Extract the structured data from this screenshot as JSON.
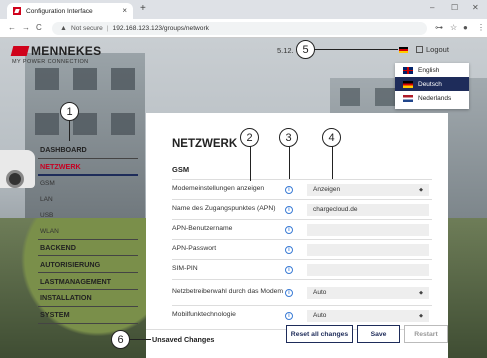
{
  "browser": {
    "tab_title": "Configuration Interface",
    "tab_close": "×",
    "new_tab": "+",
    "url_warning": "Not secure",
    "url_separator": "|",
    "url": "192.168.123.123/groups/network",
    "window_controls": [
      "–",
      "☐",
      "✕"
    ]
  },
  "header": {
    "brand": "MENNEKES",
    "tagline": "MY POWER CONNECTION",
    "version": "5.12.",
    "logout": "Logout"
  },
  "languages": [
    {
      "label": "English",
      "flag": "uk"
    },
    {
      "label": "Deutsch",
      "flag": "de",
      "selected": true
    },
    {
      "label": "Nederlands",
      "flag": "nl"
    }
  ],
  "sidebar": {
    "items": [
      {
        "label": "DASHBOARD"
      },
      {
        "label": "NETZWERK",
        "active": true
      },
      {
        "label": "GSM",
        "sub": true
      },
      {
        "label": "LAN",
        "sub": true
      },
      {
        "label": "USB",
        "sub": true
      },
      {
        "label": "WLAN",
        "sub": true
      },
      {
        "label": "BACKEND"
      },
      {
        "label": "AUTORISIERUNG"
      },
      {
        "label": "LASTMANAGEMENT"
      },
      {
        "label": "INSTALLATION"
      },
      {
        "label": "SYSTEM"
      }
    ]
  },
  "panel": {
    "title": "NETZWERK",
    "subtitle": "GSM",
    "rows": [
      {
        "label": "Modemeinstellungen anzeigen",
        "value": "Anzeigen",
        "type": "select"
      },
      {
        "label": "Name des Zugangspunktes (APN)",
        "value": "chargecloud.de",
        "type": "input"
      },
      {
        "label": "APN-Benutzername",
        "value": "",
        "type": "input"
      },
      {
        "label": "APN-Passwort",
        "value": "",
        "type": "input"
      },
      {
        "label": "SIM-PIN",
        "value": "",
        "type": "input"
      },
      {
        "label": "Netzbetreiberwahl durch das Modem",
        "value": "Auto",
        "type": "select"
      },
      {
        "label": "Mobilfunktechnologie",
        "value": "Auto",
        "type": "select"
      }
    ],
    "info_glyph": "i"
  },
  "footer": {
    "unsaved": "Unsaved Changes",
    "reset": "Reset all changes",
    "save": "Save",
    "restart": "Restart"
  },
  "callouts": [
    "1",
    "2",
    "3",
    "4",
    "5",
    "6"
  ],
  "colors": {
    "accent_red": "#c60022",
    "navy": "#1e2c5a",
    "info_blue": "#3a7bd5"
  }
}
